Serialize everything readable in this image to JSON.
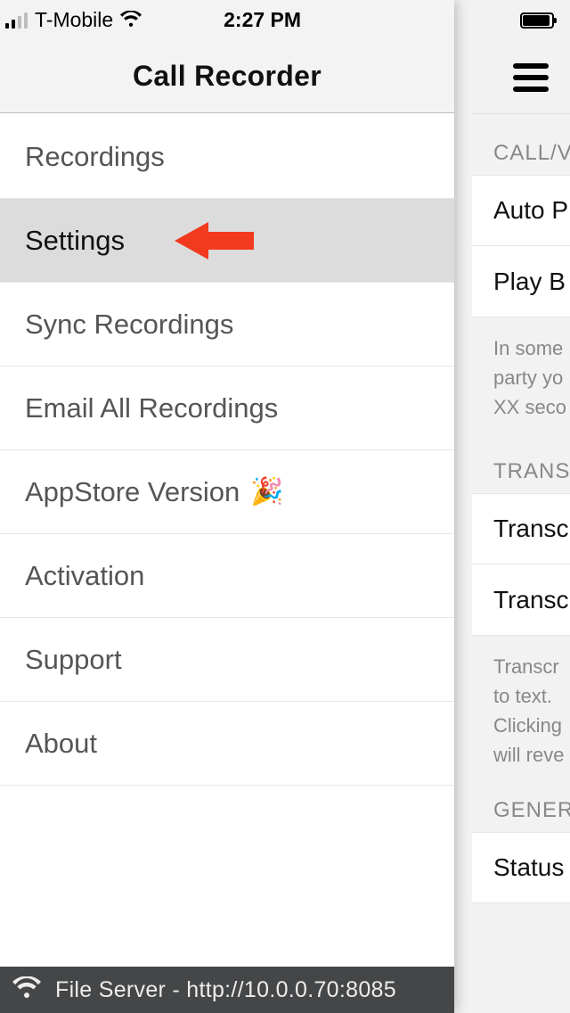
{
  "statusbar": {
    "carrier": "T-Mobile",
    "time": "2:27 PM"
  },
  "appTitle": "Call Recorder",
  "menu": {
    "items": [
      {
        "label": "Recordings"
      },
      {
        "label": "Settings",
        "selected": true,
        "annotation_arrow": true
      },
      {
        "label": "Sync Recordings"
      },
      {
        "label": "Email All Recordings"
      },
      {
        "label": "AppStore Version",
        "emoji": "🎉"
      },
      {
        "label": "Activation"
      },
      {
        "label": "Support"
      },
      {
        "label": "About"
      }
    ]
  },
  "footer": {
    "text": "File Server - http://10.0.0.70:8085"
  },
  "rightPane": {
    "sections": {
      "s1_header": "CALL/V",
      "s1_rows": [
        "Auto P",
        "Play B"
      ],
      "s1_note": [
        "In some",
        "party yo",
        "XX seco"
      ],
      "s2_header": "TRANS",
      "s2_rows": [
        "Transc",
        "Transc"
      ],
      "s2_note": [
        "Transcr",
        "to text.",
        "Clicking",
        "will reve"
      ],
      "s3_header": "GENER",
      "s3_rows": [
        "Status"
      ]
    }
  }
}
